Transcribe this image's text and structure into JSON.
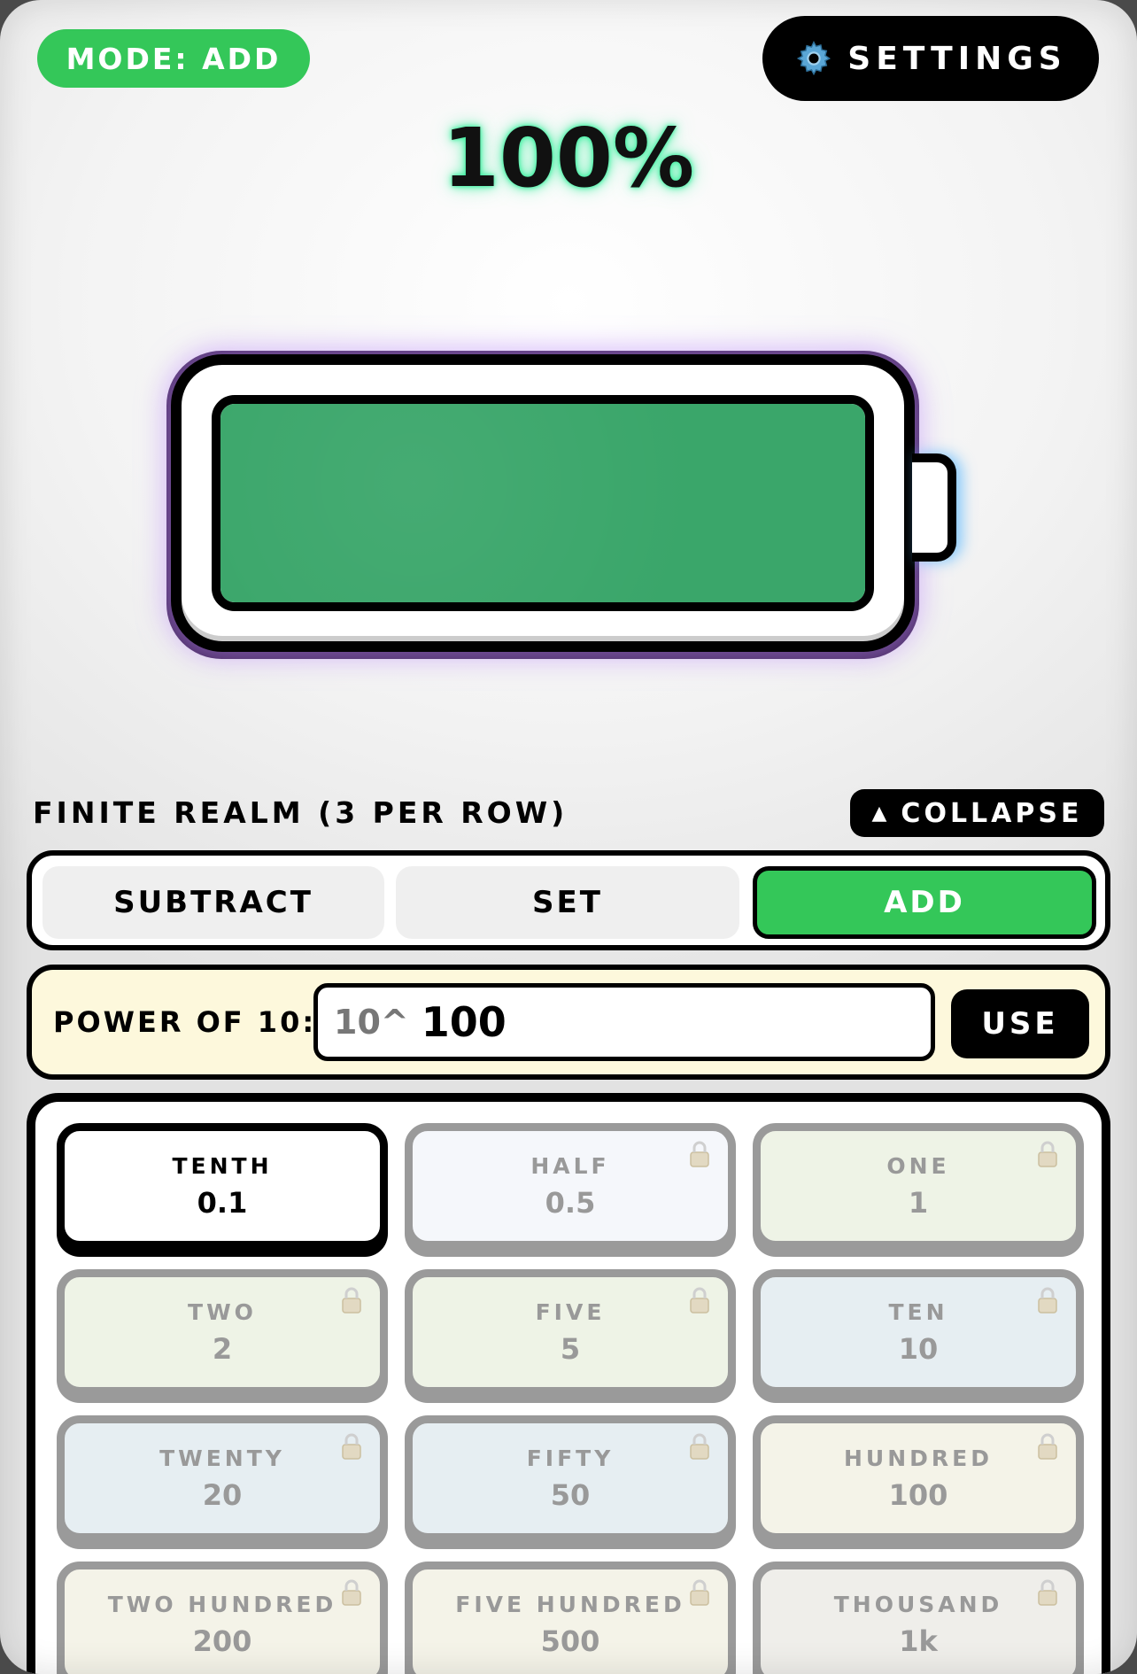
{
  "header": {
    "mode_badge": "MODE: ADD",
    "settings_label": "SETTINGS"
  },
  "battery": {
    "percent_text": "100%",
    "level": 1.0,
    "fill_color": "#3aa66a"
  },
  "realm": {
    "title": "FINITE REALM (3 PER ROW)",
    "collapse_label": "COLLAPSE"
  },
  "mode_tabs": [
    {
      "label": "SUBTRACT",
      "active": false
    },
    {
      "label": "SET",
      "active": false
    },
    {
      "label": "ADD",
      "active": true
    }
  ],
  "power": {
    "label": "POWER OF 10:",
    "prefix": "10^",
    "value": "100",
    "use_label": "USE"
  },
  "cells": [
    {
      "name": "TENTH",
      "value": "0.1",
      "locked": false,
      "active": true,
      "color": "#ffffff"
    },
    {
      "name": "HALF",
      "value": "0.5",
      "locked": true,
      "active": false,
      "color": "#f5f7fb"
    },
    {
      "name": "ONE",
      "value": "1",
      "locked": true,
      "active": false,
      "color": "#eef3e6"
    },
    {
      "name": "TWO",
      "value": "2",
      "locked": true,
      "active": false,
      "color": "#eef3e6"
    },
    {
      "name": "FIVE",
      "value": "5",
      "locked": true,
      "active": false,
      "color": "#eef3e6"
    },
    {
      "name": "TEN",
      "value": "10",
      "locked": true,
      "active": false,
      "color": "#e6eef2"
    },
    {
      "name": "TWENTY",
      "value": "20",
      "locked": true,
      "active": false,
      "color": "#e6eef2"
    },
    {
      "name": "FIFTY",
      "value": "50",
      "locked": true,
      "active": false,
      "color": "#e6eef2"
    },
    {
      "name": "HUNDRED",
      "value": "100",
      "locked": true,
      "active": false,
      "color": "#f4f3e8"
    },
    {
      "name": "TWO HUNDRED",
      "value": "200",
      "locked": true,
      "active": false,
      "color": "#f4f3e8"
    },
    {
      "name": "FIVE HUNDRED",
      "value": "500",
      "locked": true,
      "active": false,
      "color": "#f4f3e8"
    },
    {
      "name": "THOUSAND",
      "value": "1k",
      "locked": true,
      "active": false,
      "color": "#efeeea"
    }
  ]
}
